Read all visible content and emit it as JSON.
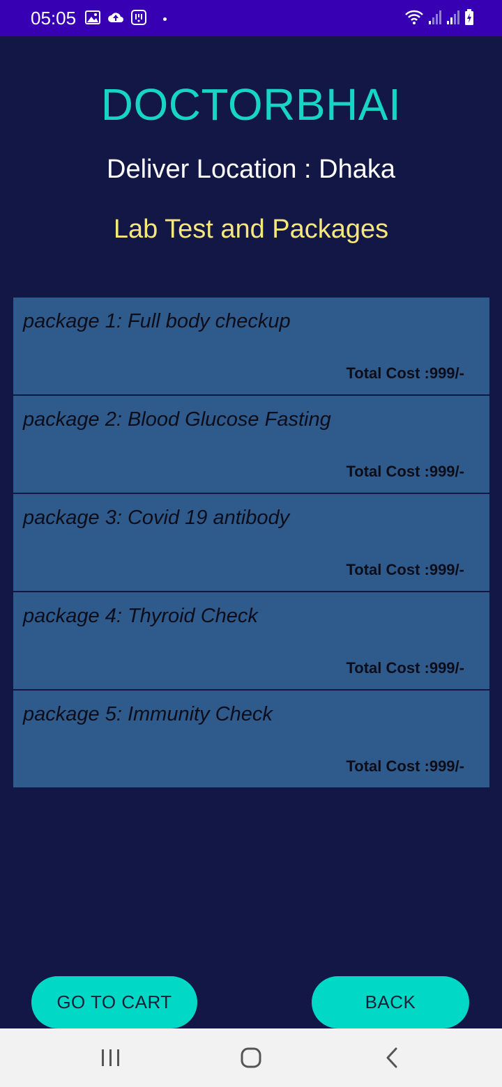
{
  "status_bar": {
    "time": "05:05",
    "left_icons": [
      "image-icon",
      "cloud-upload-icon",
      "app-notification-icon"
    ],
    "right_icons": [
      "wifi-icon",
      "signal-icon",
      "signal-icon",
      "battery-charging-icon"
    ]
  },
  "header": {
    "app_title": "DOCTORBHAI",
    "location": "Deliver Location : Dhaka",
    "section_title": "Lab Test and Packages"
  },
  "packages": [
    {
      "name": "package 1: Full body checkup",
      "cost": "Total Cost :999/-"
    },
    {
      "name": "package 2: Blood Glucose Fasting",
      "cost": "Total Cost :999/-"
    },
    {
      "name": "package 3: Covid 19 antibody",
      "cost": "Total Cost :999/-"
    },
    {
      "name": "package 4: Thyroid Check",
      "cost": "Total Cost :999/-"
    },
    {
      "name": "package 5: Immunity Check",
      "cost": "Total Cost :999/-"
    }
  ],
  "actions": {
    "cart_label": "GO TO CART",
    "back_label": "BACK"
  },
  "colors": {
    "background": "#131745",
    "status_bar": "#3700b3",
    "title": "#17d4c4",
    "section_title": "#f5e77e",
    "package_bg": "#2e5b8c",
    "button": "#02d8c6"
  }
}
